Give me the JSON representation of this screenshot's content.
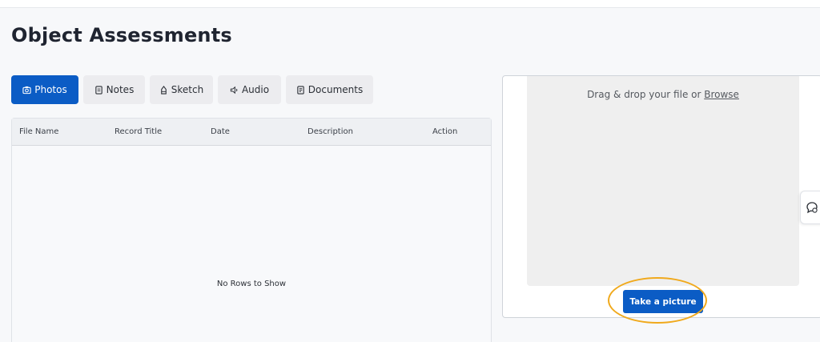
{
  "page": {
    "title": "Object Assessments"
  },
  "tabs": [
    {
      "label": "Photos",
      "icon": "photo-icon",
      "active": true
    },
    {
      "label": "Notes",
      "icon": "note-icon",
      "active": false
    },
    {
      "label": "Sketch",
      "icon": "sketch-icon",
      "active": false
    },
    {
      "label": "Audio",
      "icon": "audio-icon",
      "active": false
    },
    {
      "label": "Documents",
      "icon": "document-icon",
      "active": false
    }
  ],
  "grid": {
    "columns": [
      "File Name",
      "Record Title",
      "Date",
      "Description",
      "Action"
    ],
    "empty_message": "No Rows to Show"
  },
  "upload": {
    "drop_text": "Drag & drop your file or ",
    "browse_label": "Browse",
    "take_picture_label": "Take a picture"
  },
  "colors": {
    "primary": "#0b5cc5",
    "highlight": "#f0a91c",
    "tab_bg": "#ececef"
  }
}
